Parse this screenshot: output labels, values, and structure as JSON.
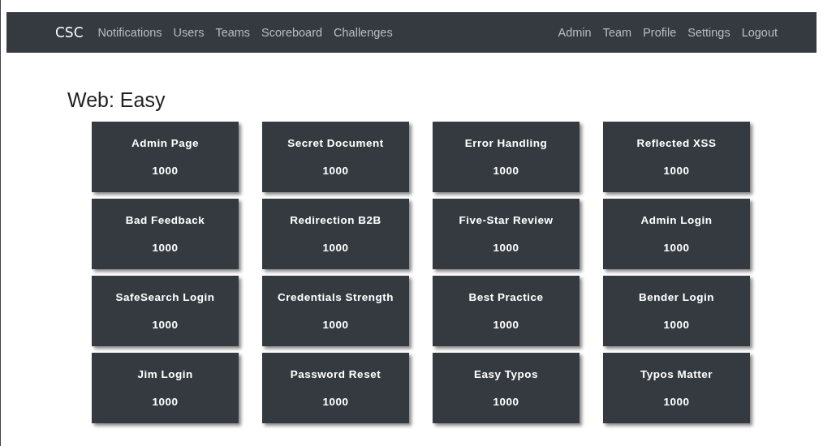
{
  "navbar": {
    "brand": "CSC",
    "left_links": [
      "Notifications",
      "Users",
      "Teams",
      "Scoreboard",
      "Challenges"
    ],
    "right_links": [
      "Admin",
      "Team",
      "Profile",
      "Settings",
      "Logout"
    ]
  },
  "category": {
    "title": "Web: Easy",
    "challenges": [
      {
        "name": "Admin Page",
        "points": "1000"
      },
      {
        "name": "Secret Document",
        "points": "1000"
      },
      {
        "name": "Error Handling",
        "points": "1000"
      },
      {
        "name": "Reflected XSS",
        "points": "1000"
      },
      {
        "name": "Bad Feedback",
        "points": "1000"
      },
      {
        "name": "Redirection B2B",
        "points": "1000"
      },
      {
        "name": "Five-Star Review",
        "points": "1000"
      },
      {
        "name": "Admin Login",
        "points": "1000"
      },
      {
        "name": "SafeSearch Login",
        "points": "1000"
      },
      {
        "name": "Credentials Strength",
        "points": "1000"
      },
      {
        "name": "Best Practice",
        "points": "1000"
      },
      {
        "name": "Bender Login",
        "points": "1000"
      },
      {
        "name": "Jim Login",
        "points": "1000"
      },
      {
        "name": "Password Reset",
        "points": "1000"
      },
      {
        "name": "Easy Typos",
        "points": "1000"
      },
      {
        "name": "Typos Matter",
        "points": "1000"
      }
    ]
  }
}
